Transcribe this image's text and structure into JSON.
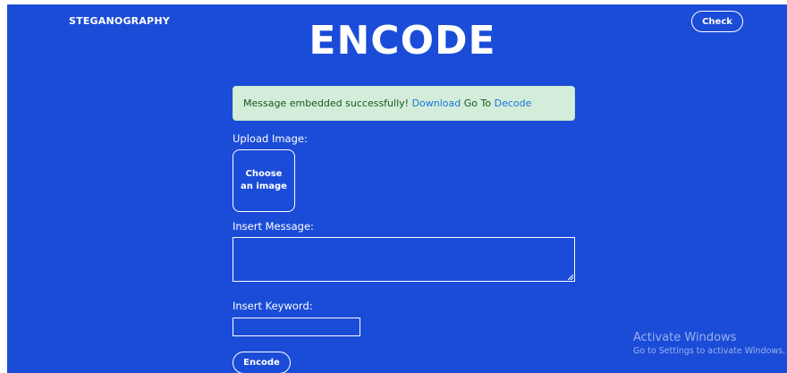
{
  "header": {
    "brand": "STEGANOGRAPHY",
    "check_label": "Check",
    "title": "ENCODE"
  },
  "alert": {
    "message": "Message embedded successfully!",
    "download_link": "Download",
    "goto_text": "Go To",
    "decode_link": "Decode"
  },
  "form": {
    "upload_label": "Upload Image:",
    "upload_button": "Choose an image",
    "message_label": "Insert Message:",
    "message_value": "",
    "keyword_label": "Insert Keyword:",
    "keyword_value": "",
    "submit_label": "Encode"
  },
  "watermark": {
    "title": "Activate Windows",
    "subtitle": "Go to Settings to activate Windows."
  },
  "colors": {
    "background": "#1b4cd7",
    "alert_background": "#d4edda",
    "alert_text": "#155724",
    "link": "#1a73d9"
  }
}
